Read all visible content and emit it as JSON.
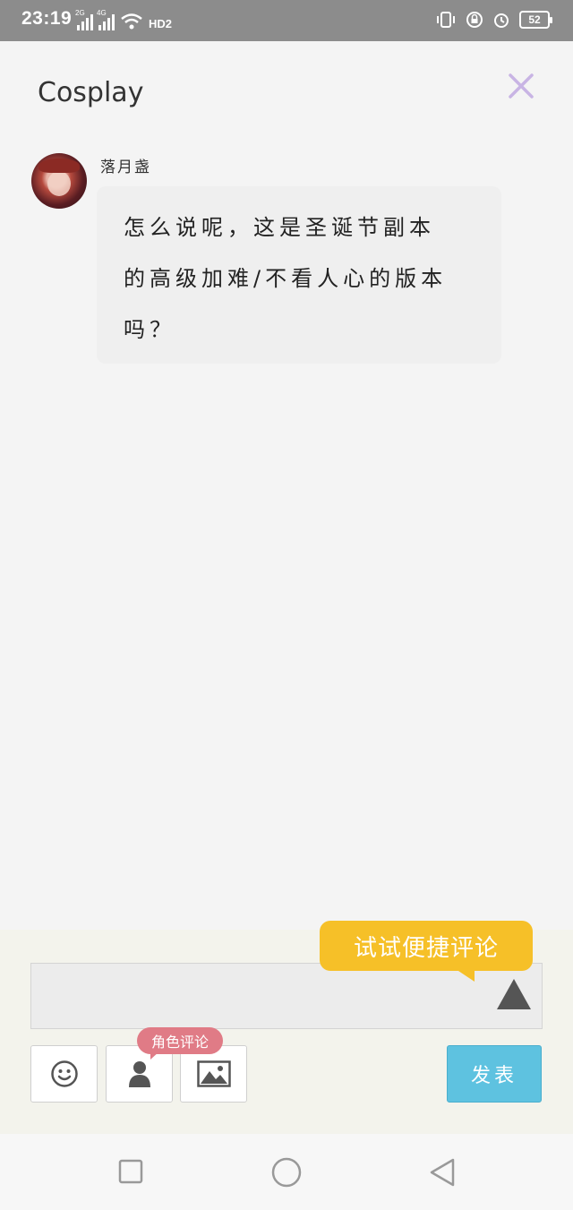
{
  "status_bar": {
    "time": "23:19",
    "net1": "2G",
    "net2": "4G",
    "hd": "HD2",
    "battery": "52"
  },
  "header": {
    "title": "Cosplay"
  },
  "comment": {
    "username": "落月盏",
    "lines": [
      "怎么说呢，这是圣诞节副本",
      "的高级加难/不看人心的版本",
      "吗？"
    ]
  },
  "composer": {
    "tooltip": "试试便捷评论",
    "role_badge": "角色评论",
    "send_label": "发表",
    "input_value": ""
  },
  "colors": {
    "status_bar": "#8c8c8c",
    "close_icon": "#c8b4e4",
    "tooltip_bg": "#f6c028",
    "badge_bg": "#e07b86",
    "send_bg": "#5ec2e0"
  },
  "icons": {
    "close": "close-icon",
    "emoji": "emoji-icon",
    "role": "person-icon",
    "image": "image-icon",
    "expand": "triangle-up-icon"
  }
}
